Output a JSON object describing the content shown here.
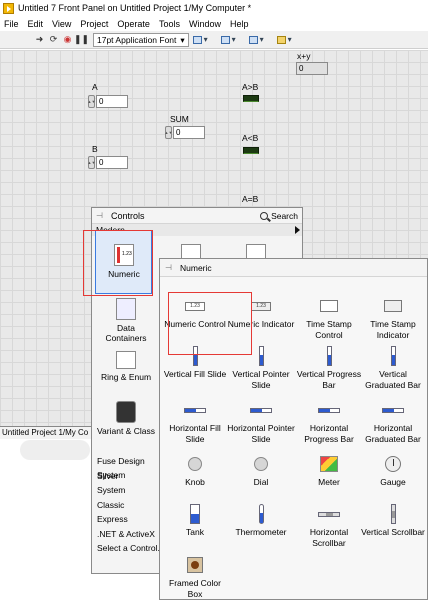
{
  "window": {
    "title": "Untitled 7 Front Panel on Untitled Project 1/My Computer *"
  },
  "menu": [
    "File",
    "Edit",
    "View",
    "Project",
    "Operate",
    "Tools",
    "Window",
    "Help"
  ],
  "toolbar": {
    "font": "17pt Application Font"
  },
  "panel": {
    "xy_label": "x+y",
    "xy_value": "0",
    "a_label": "A",
    "a_value": "0",
    "sum_label": "SUM",
    "sum_value": "0",
    "b_label": "B",
    "b_value": "0",
    "agtb_label": "A>B",
    "altb_label": "A<B",
    "aeqb_label": "A=B",
    "num_icon_text": "1.23"
  },
  "project_strip": "Untitled Project 1/My Co",
  "controls": {
    "title": "Controls",
    "search": "Search",
    "modern": "Modern",
    "categories": [
      "Numeric",
      "Data Containers",
      "Ring & Enum",
      "Variant & Class"
    ],
    "list": [
      "Fuse Design System",
      "Silver",
      "System",
      "Classic",
      "Express",
      ".NET & ActiveX",
      "Select a Control..."
    ]
  },
  "numeric": {
    "title": "Numeric",
    "items": [
      "Numeric Control",
      "Numeric Indicator",
      "Time Stamp Control",
      "Time Stamp Indicator",
      "Vertical Fill Slide",
      "Vertical Pointer Slide",
      "Vertical Progress Bar",
      "Vertical Graduated Bar",
      "Horizontal Fill Slide",
      "Horizontal Pointer Slide",
      "Horizontal Progress Bar",
      "Horizontal Graduated Bar",
      "Knob",
      "Dial",
      "Meter",
      "Gauge",
      "Tank",
      "Thermometer",
      "Horizontal Scrollbar",
      "Vertical Scrollbar",
      "Framed Color Box"
    ]
  }
}
